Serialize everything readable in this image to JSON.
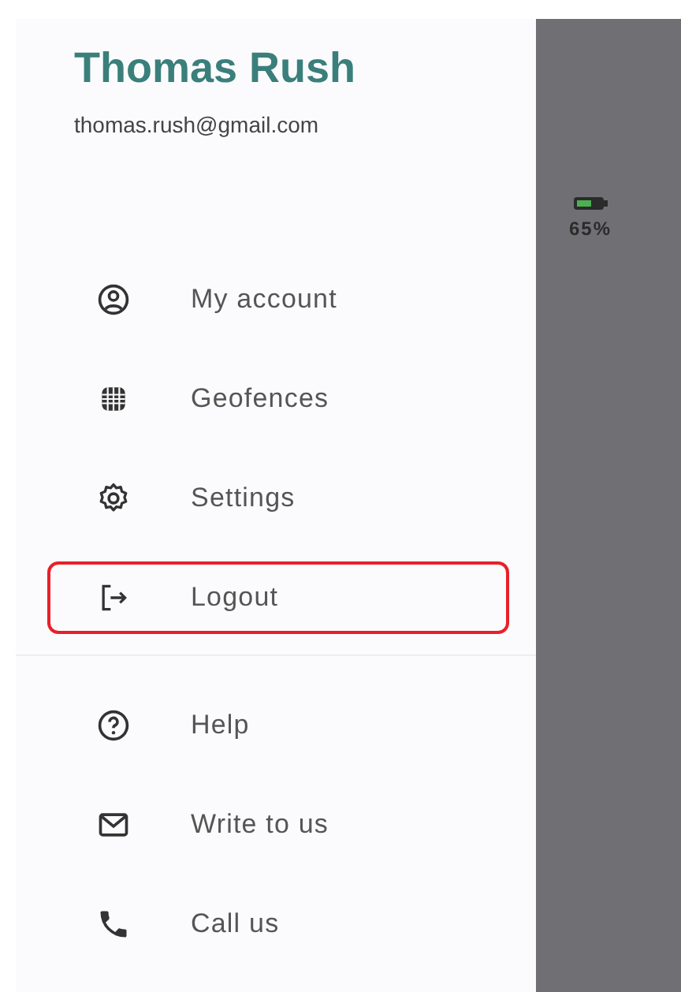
{
  "drawer": {
    "name": "Thomas Rush",
    "email": "thomas.rush@gmail.com",
    "groups": [
      [
        {
          "label": "My account",
          "highlighted": false
        },
        {
          "label": "Geofences",
          "highlighted": false
        },
        {
          "label": "Settings",
          "highlighted": false
        },
        {
          "label": "Logout",
          "highlighted": true
        }
      ],
      [
        {
          "label": "Help",
          "highlighted": false
        },
        {
          "label": "Write to us",
          "highlighted": false
        },
        {
          "label": "Call us",
          "highlighted": false
        }
      ]
    ]
  },
  "background": {
    "battery_reading": "65%"
  }
}
